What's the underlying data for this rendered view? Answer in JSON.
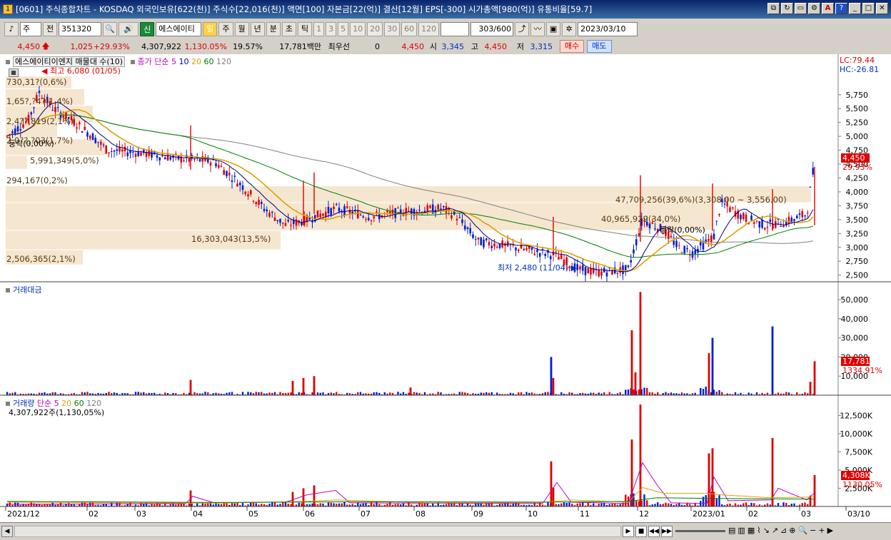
{
  "window": {
    "title": "[0601] 주식종합차트 - KOSDAQ 외국인보유[622(천)] 주식수[22,016(천)] 액면[100] 자본금[22(억)] 결산[12월] EPS[-300] 시가총액[980(억)] 유통비율[59.7]",
    "app_icon": "1",
    "buttons": [
      "window-link-icon",
      "refresh-icon",
      "restore-small-icon",
      "settings-icon",
      "font-icon",
      "help-icon",
      "minimize-icon",
      "maximize-icon",
      "close-icon"
    ]
  },
  "toolbar": {
    "market_select": "주",
    "prev_label": "전",
    "code": "351320",
    "stock_name": "에스에이티",
    "shin_badge": "신",
    "periods": [
      "일",
      "주",
      "월",
      "년",
      "분",
      "초",
      "틱"
    ],
    "active_period": "일",
    "minutes": [
      "1",
      "3",
      "5",
      "10",
      "20",
      "30",
      "60",
      "120"
    ],
    "count_value": "303",
    "count_total": "/600",
    "date": "2023/03/10"
  },
  "quote": {
    "price": "4,450",
    "change_icon": "up-arrow-icon",
    "change": "1,025",
    "change_pct": "+29.93%",
    "volume": "4,307,922",
    "vol_ratio": "1,130.05%",
    "turnover": "19.57%",
    "amount": "17,781백만",
    "best_label": "최우선",
    "best_value": "0",
    "best_price": "4,450",
    "open_label": "시",
    "open": "3,345",
    "high_label": "고",
    "high": "4,450",
    "low_label": "저",
    "low": "3,315",
    "buy_label": "매수",
    "sell_label": "매도"
  },
  "price_panel": {
    "legend_stock": "에스에이티이엔지 매물대 수(10)",
    "legend_ma": [
      "종가 단순 5",
      "10",
      "20",
      "60",
      "120"
    ],
    "legend_ma_colors": [
      "#c000c0",
      "#0000c0",
      "#e0a000",
      "#008000",
      "#808080"
    ],
    "lc": "LC:79.44",
    "hc": "HC:-26.81",
    "high_note": "최고 6,080 (01/05)",
    "low_note": "최저 2,480 (11/04)",
    "current_tag": "4,450",
    "current_pct": "29.93%",
    "y_ticks": [
      "5,750",
      "5,500",
      "5,250",
      "5,000",
      "4,750",
      "4,500",
      "4,250",
      "4,000",
      "3,750",
      "3,500",
      "3,250",
      "3,000",
      "2,750",
      "2,500"
    ],
    "volume_profile_labels": [
      "730,31?(0,6%)",
      "1,65?,?4?(1,4%)",
      "2,4??,819(2,1%)",
      "2,0??,?03(1,7%)",
      "5,991,349(5,0%)",
      "294,167(0,2%)",
      "47,709,256(39,6%)(3,308.00 ~ 3,556.00)",
      "40,965,929(34,0%)",
      "16,303,043(13,5%)",
      "2,506,365(2,1%)",
      "등락(0,00%)",
      "등락(0,00%)"
    ]
  },
  "amount_panel": {
    "title": "거래대금",
    "y_ticks": [
      "50,000",
      "40,000",
      "30,000",
      "20,000",
      "10,000"
    ],
    "current_tag": "17,781",
    "current_pct": "1334.91%"
  },
  "volume_panel": {
    "title": "거래량",
    "legend": [
      "단순 5",
      "20",
      "60",
      "120"
    ],
    "legend_colors": [
      "#c000c0",
      "#e0a000",
      "#008000",
      "#808080"
    ],
    "summary": "4,307,922주(1,130,05%)",
    "y_ticks": [
      "12,500K",
      "10,000K",
      "7,500K",
      "5,000K",
      "2,500K"
    ],
    "current_tag": "4,308K",
    "current_pct": "1130.05%"
  },
  "x_axis": [
    "2021/12",
    "02",
    "03",
    "04",
    "05",
    "06",
    "07",
    "08",
    "09",
    "10",
    "11",
    "12",
    "2023/01",
    "02",
    "03",
    "03/10"
  ],
  "colors": {
    "up": "#e00000",
    "down": "#0020d0",
    "profile": "#f5e6d0",
    "ma5": "#c000c0",
    "ma10": "#000080",
    "ma20": "#e0a000",
    "ma60": "#008000",
    "ma120": "#808080"
  }
}
